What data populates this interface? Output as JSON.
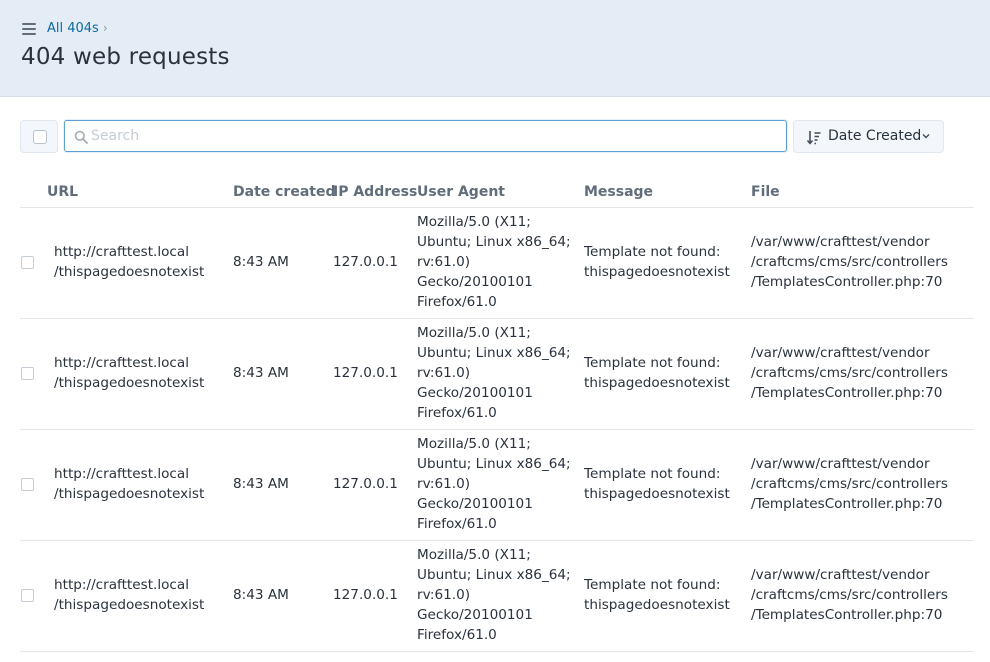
{
  "breadcrumb": {
    "link": "All 404s",
    "separator": "›"
  },
  "page_title": "404 web requests",
  "search": {
    "placeholder": "Search",
    "value": ""
  },
  "sort": {
    "label": "Date Created"
  },
  "columns": [
    "URL",
    "Date created",
    "IP Address",
    "User Agent",
    "Message",
    "File"
  ],
  "rows": [
    {
      "url": [
        "http://crafttest.local",
        "/thispagedoesnotexist"
      ],
      "date": "8:43 AM",
      "ip": "127.0.0.1",
      "ua": [
        "Mozilla/5.0 (X11;",
        "Ubuntu; Linux x86_64;",
        "rv:61.0)",
        "Gecko/20100101",
        "Firefox/61.0"
      ],
      "message": [
        "Template not found:",
        "thispagedoesnotexist"
      ],
      "file": [
        "/var/www/crafttest/vendor",
        "/craftcms/cms/src/controllers",
        "/TemplatesController.php:70"
      ]
    },
    {
      "url": [
        "http://crafttest.local",
        "/thispagedoesnotexist"
      ],
      "date": "8:43 AM",
      "ip": "127.0.0.1",
      "ua": [
        "Mozilla/5.0 (X11;",
        "Ubuntu; Linux x86_64;",
        "rv:61.0)",
        "Gecko/20100101",
        "Firefox/61.0"
      ],
      "message": [
        "Template not found:",
        "thispagedoesnotexist"
      ],
      "file": [
        "/var/www/crafttest/vendor",
        "/craftcms/cms/src/controllers",
        "/TemplatesController.php:70"
      ]
    },
    {
      "url": [
        "http://crafttest.local",
        "/thispagedoesnotexist"
      ],
      "date": "8:43 AM",
      "ip": "127.0.0.1",
      "ua": [
        "Mozilla/5.0 (X11;",
        "Ubuntu; Linux x86_64;",
        "rv:61.0)",
        "Gecko/20100101",
        "Firefox/61.0"
      ],
      "message": [
        "Template not found:",
        "thispagedoesnotexist"
      ],
      "file": [
        "/var/www/crafttest/vendor",
        "/craftcms/cms/src/controllers",
        "/TemplatesController.php:70"
      ]
    },
    {
      "url": [
        "http://crafttest.local",
        "/thispagedoesnotexist"
      ],
      "date": "8:43 AM",
      "ip": "127.0.0.1",
      "ua": [
        "Mozilla/5.0 (X11;",
        "Ubuntu; Linux x86_64;",
        "rv:61.0)",
        "Gecko/20100101",
        "Firefox/61.0"
      ],
      "message": [
        "Template not found:",
        "thispagedoesnotexist"
      ],
      "file": [
        "/var/www/crafttest/vendor",
        "/craftcms/cms/src/controllers",
        "/TemplatesController.php:70"
      ]
    }
  ]
}
